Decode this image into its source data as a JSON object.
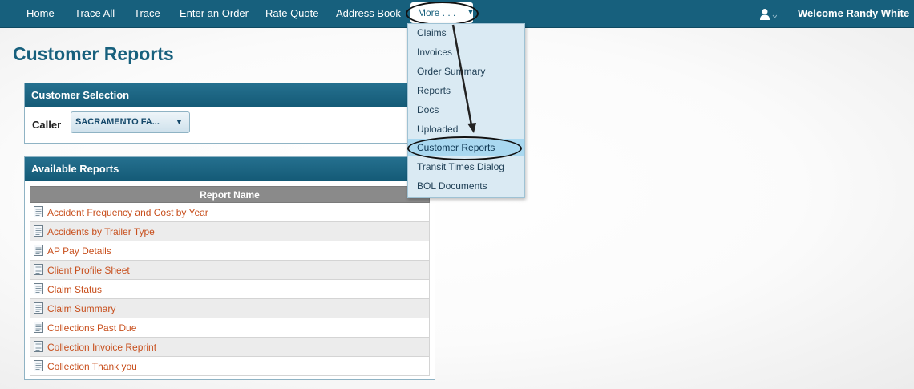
{
  "nav": {
    "items": [
      "Home",
      "Trace All",
      "Trace",
      "Enter an Order",
      "Rate Quote",
      "Address Book"
    ],
    "more_label": "More . . .",
    "welcome": "Welcome Randy White",
    "icons": {
      "user": "user-icon",
      "more_caret": "caret-down-icon"
    }
  },
  "page": {
    "title": "Customer Reports"
  },
  "customer_selection": {
    "title": "Customer Selection",
    "caller_label": "Caller",
    "caller_value": "SACRAMENTO FA..."
  },
  "available_reports": {
    "title": "Available Reports",
    "column_header": "Report Name",
    "rows": [
      "Accident Frequency and Cost by Year",
      "Accidents by Trailer Type",
      "AP Pay Details",
      "Client Profile Sheet",
      "Claim Status",
      "Claim Summary",
      "Collections Past Due",
      "Collection Invoice Reprint",
      "Collection Thank you"
    ]
  },
  "more_menu": {
    "items": [
      "Claims",
      "Invoices",
      "Order Summary",
      "Reports",
      "Docs",
      "Uploaded",
      "Customer Reports",
      "Transit Times Dialog",
      "BOL Documents"
    ],
    "highlighted": "Customer Reports"
  },
  "colors": {
    "nav_bg": "#17607d",
    "title": "#17607d",
    "link": "#c8501e",
    "menu_bg": "#daeaf3",
    "menu_highlight": "#a9d8f0"
  }
}
